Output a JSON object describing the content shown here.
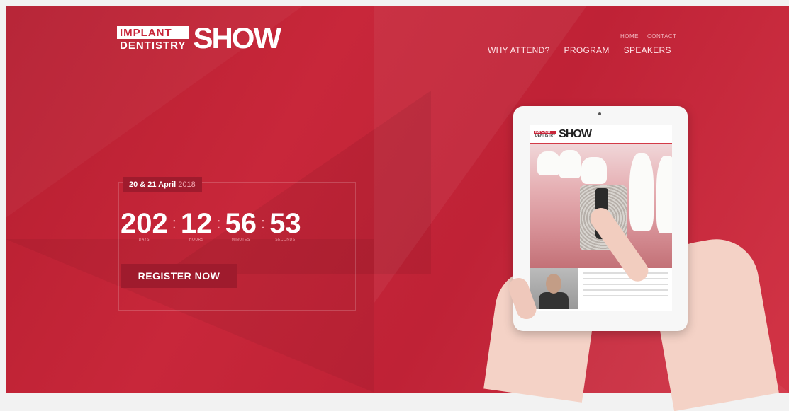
{
  "brand": {
    "logo_line1": "IMPLANT",
    "logo_line2": "DENTISTRY",
    "logo_show": "SHOW"
  },
  "nav": {
    "secondary": [
      "HOME",
      "CONTACT"
    ],
    "primary": [
      "WHY ATTEND?",
      "PROGRAM",
      "SPEAKERS"
    ]
  },
  "event": {
    "date_bold": "20 & 21 April",
    "date_year": "2018"
  },
  "countdown": [
    {
      "value": "202",
      "label": "DAYS"
    },
    {
      "value": "12",
      "label": "HOURS"
    },
    {
      "value": "56",
      "label": "MINUTES"
    },
    {
      "value": "53",
      "label": "SECONDS"
    }
  ],
  "cta": {
    "register_label": "REGISTER NOW"
  },
  "tablet_screen": {
    "logo_line1": "IMPLANT",
    "logo_line2": "DENTISTRY",
    "logo_show": "SHOW"
  },
  "colors": {
    "brand_red": "#c8273a",
    "badge_red": "#9f1b2d"
  }
}
